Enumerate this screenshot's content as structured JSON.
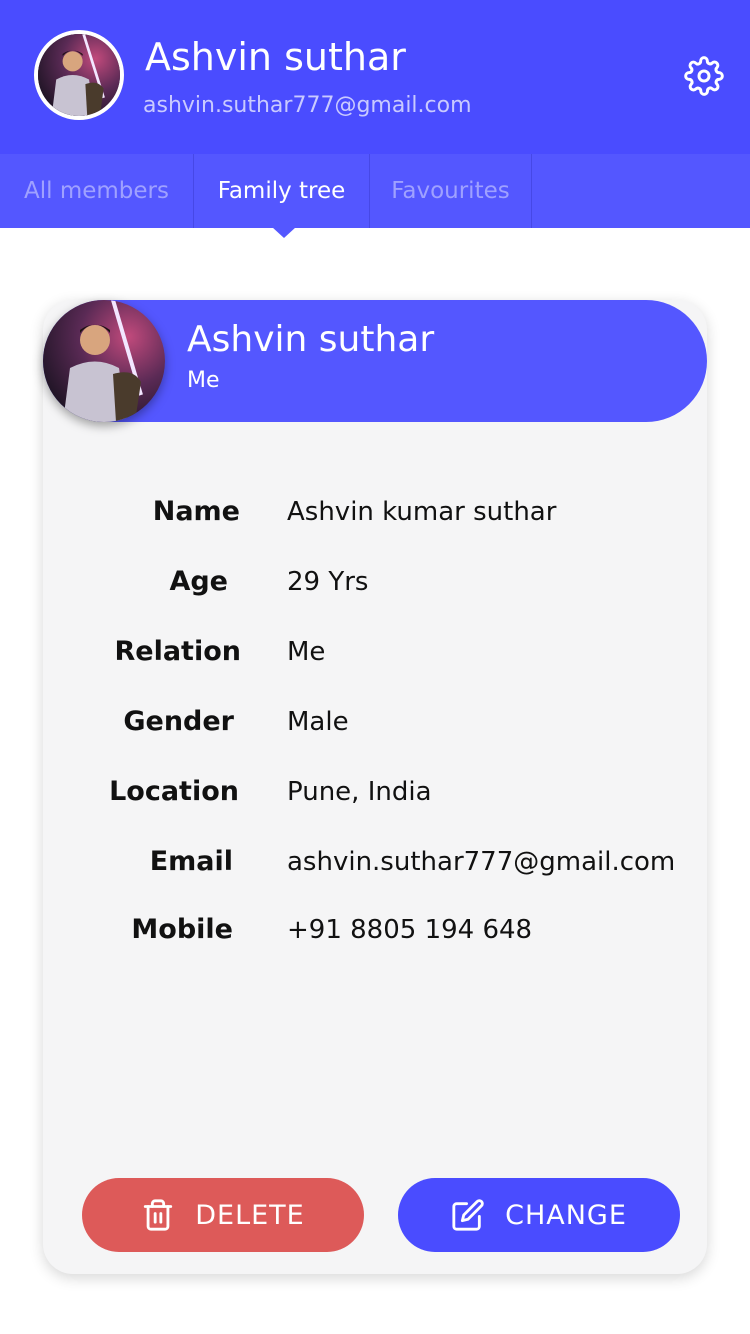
{
  "header": {
    "user_name": "Ashvin suthar",
    "user_email": "ashvin.suthar777@gmail.com",
    "settings_icon": "gear-icon"
  },
  "tabs": [
    {
      "label": "All members",
      "active": false
    },
    {
      "label": "Family tree",
      "active": true
    },
    {
      "label": "Favourites",
      "active": false
    }
  ],
  "card": {
    "name": "Ashvin suthar",
    "subtitle": "Me",
    "details": [
      {
        "label": "Name",
        "value": "Ashvin kumar suthar"
      },
      {
        "label": "Age",
        "value": "29 Yrs"
      },
      {
        "label": "Relation",
        "value": "Me"
      },
      {
        "label": "Gender",
        "value": "Male"
      },
      {
        "label": "Location",
        "value": "Pune, India"
      },
      {
        "label": "Email",
        "value": "ashvin.suthar777@gmail.com"
      },
      {
        "label": "Mobile",
        "value": "+91 8805 194 648"
      }
    ]
  },
  "actions": {
    "delete_label": "DELETE",
    "delete_icon": "trash-icon",
    "change_label": "CHANGE",
    "change_icon": "edit-icon"
  },
  "colors": {
    "primary": "#4a4cff",
    "tab_bar": "#5457ff",
    "delete": "#dd5a59",
    "card_bg": "#f5f5f6"
  }
}
